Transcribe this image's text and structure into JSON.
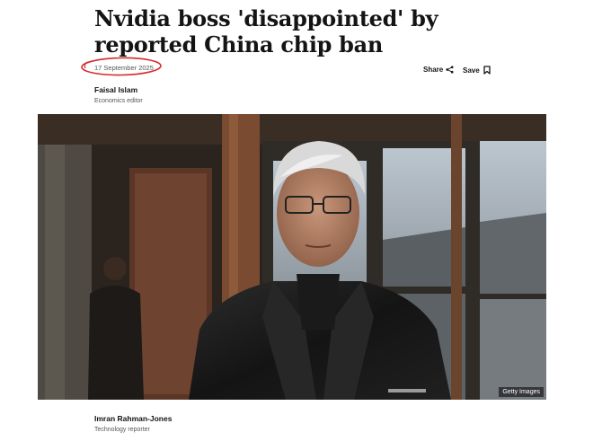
{
  "article": {
    "headline": "Nvidia boss 'disappointed' by reported China chip ban",
    "date": "17 September 2025"
  },
  "actions": {
    "share_label": "Share",
    "save_label": "Save",
    "share_icon": "share-icon",
    "save_icon": "bookmark-icon"
  },
  "byline": {
    "name": "Faisal Islam",
    "role": "Economics editor"
  },
  "image": {
    "credit": "Getty Images"
  },
  "byline2": {
    "name": "Imran Rahman-Jones",
    "role": "Technology reporter"
  },
  "colors": {
    "text": "#141414",
    "muted": "#545658",
    "annotation_circle": "#d42a2a"
  }
}
